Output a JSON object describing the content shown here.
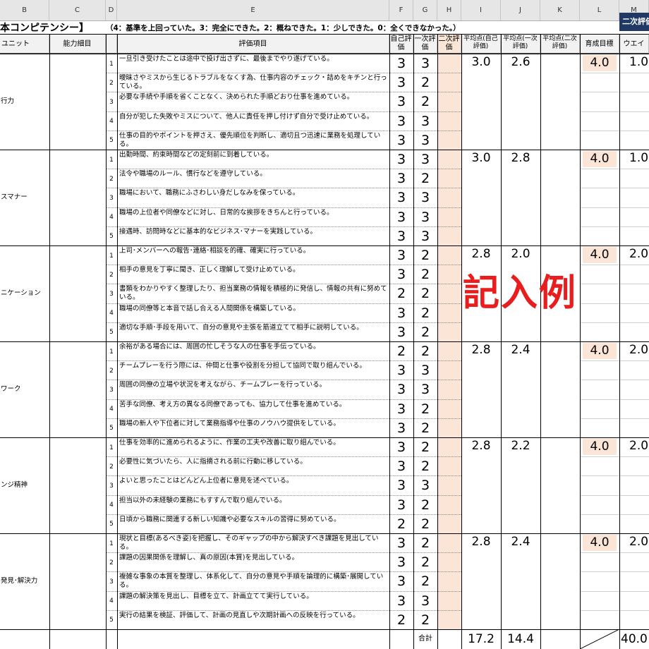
{
  "column_letters": [
    "B",
    "C",
    "D",
    "E",
    "F",
    "G",
    "H",
    "I",
    "J",
    "K",
    "L",
    "M"
  ],
  "title": "本コンピテンシー】",
  "legend": "（4：基準を上回っていた。3：完全にできた。2：概ねできた。1：少しできた。0：全くできなかった。）",
  "second_eval_tag": "二次評価",
  "headers": {
    "unit": "ユニット",
    "ability": "能力細目",
    "items": "評価項目",
    "self_eval": "自己評価",
    "first_eval": "一次評価",
    "second_eval": "二次評価",
    "avg_self": "平均点(自己評価)",
    "avg_first": "平均点(一次評価)",
    "avg_second": "平均点(二次評価)",
    "target": "育成目標",
    "weight": "ウエイ"
  },
  "watermark": "記入例",
  "groups": [
    {
      "unit": "行力",
      "avg_self": "3.0",
      "avg_first": "2.6",
      "target": "4.0",
      "weight": "1.0",
      "items": [
        {
          "no": "1",
          "text": "一旦引き受けたことは途中で投げ出さずに、最後までやり遂げている。",
          "self": "3",
          "first": "3"
        },
        {
          "no": "2",
          "text": "曖昧さやミスから生じるトラブルをなくす為、仕事内容のチェック・詰めをキチンと行っている。",
          "self": "3",
          "first": "2"
        },
        {
          "no": "3",
          "text": "必要な手続や手順を省くことなく、決められた手順どおり仕事を進めている。",
          "self": "3",
          "first": "2"
        },
        {
          "no": "4",
          "text": "自分が犯した失敗やミスについて、他人に責任を押し付けず自分で受け止めている。",
          "self": "3",
          "first": "3"
        },
        {
          "no": "5",
          "text": "仕事の目的やポイントを押さえ、優先順位を判断し、適切且つ迅速に業務を処理している。",
          "self": "3",
          "first": "3"
        }
      ]
    },
    {
      "unit": "スマナー",
      "avg_self": "3.0",
      "avg_first": "2.8",
      "target": "4.0",
      "weight": "1.0",
      "items": [
        {
          "no": "1",
          "text": "出勤時間、約束時間などの定刻前に到着している。",
          "self": "3",
          "first": "3"
        },
        {
          "no": "2",
          "text": "法令や職場のルール、慣行などを遵守している。",
          "self": "3",
          "first": "2"
        },
        {
          "no": "3",
          "text": "職場において、職務にふさわしい身だしなみを保っている。",
          "self": "3",
          "first": "3"
        },
        {
          "no": "4",
          "text": "職場の上位者や同僚などに対し、日常的な挨拶をきちんと行っている。",
          "self": "3",
          "first": "3"
        },
        {
          "no": "5",
          "text": "接遇時、訪問時などに基本的なビジネス･マナーを実践している。",
          "self": "3",
          "first": "3"
        }
      ]
    },
    {
      "unit": "ニケーション",
      "avg_self": "2.8",
      "avg_first": "2.0",
      "target": "4.0",
      "weight": "2.0",
      "items": [
        {
          "no": "1",
          "text": "上司･メンバーへの報告･連絡･相談を的確、確実に行っている。",
          "self": "3",
          "first": "2"
        },
        {
          "no": "2",
          "text": "相手の意見を丁寧に聞き、正しく理解して受け止めている。",
          "self": "3",
          "first": "2"
        },
        {
          "no": "3",
          "text": "書類をわかりやすく整理したり、担当業務の情報を積極的に発信し、情報の共有に努めている。",
          "self": "2",
          "first": "2"
        },
        {
          "no": "4",
          "text": "職場の同僚等と本音で話し合える人間関係を構築している。",
          "self": "3",
          "first": "2"
        },
        {
          "no": "5",
          "text": "適切な手順･手段を用いて、自分の意見や主張を筋道立てて相手に説明している。",
          "self": "3",
          "first": "2"
        }
      ]
    },
    {
      "unit": "ワーク",
      "avg_self": "2.8",
      "avg_first": "2.4",
      "target": "4.0",
      "weight": "2.0",
      "items": [
        {
          "no": "1",
          "text": "余裕がある場合には、周囲の忙しそうな人の仕事を手伝っている。",
          "self": "2",
          "first": "2"
        },
        {
          "no": "2",
          "text": "チームプレーを行う際には、仲間と仕事や役割を分担して協同で取り組んでいる。",
          "self": "3",
          "first": "3"
        },
        {
          "no": "3",
          "text": "周囲の同僚の立場や状況を考えながら、チームプレーを行っている。",
          "self": "3",
          "first": "3"
        },
        {
          "no": "4",
          "text": "苦手な同僚、考え方の異なる同僚であっても、協力して仕事を進めている。",
          "self": "3",
          "first": "2"
        },
        {
          "no": "5",
          "text": "職場の新人や下位者に対して業務指導や仕事のノウハウ提供をしている。",
          "self": "3",
          "first": "2"
        }
      ]
    },
    {
      "unit": "ンジ精神",
      "avg_self": "2.8",
      "avg_first": "2.2",
      "target": "4.0",
      "weight": "2.0",
      "items": [
        {
          "no": "1",
          "text": "仕事を効率的に進められるように、作業の工夫や改善に取り組んでいる。",
          "self": "3",
          "first": "2"
        },
        {
          "no": "2",
          "text": "必要性に気づいたら、人に指摘される前に行動に移している。",
          "self": "3",
          "first": "2"
        },
        {
          "no": "3",
          "text": "よいと思ったことはどんどん上位者に意見を述べている。",
          "self": "3",
          "first": "3"
        },
        {
          "no": "4",
          "text": "担当以外の未経験の業務にもすすんで取り組んでいる。",
          "self": "3",
          "first": "2"
        },
        {
          "no": "5",
          "text": "日頃から職務に関連する新しい知識や必要なスキルの習得に努めている。",
          "self": "2",
          "first": "2"
        }
      ]
    },
    {
      "unit": "発見･解決力",
      "avg_self": "2.8",
      "avg_first": "2.4",
      "target": "4.0",
      "weight": "2.0",
      "items": [
        {
          "no": "1",
          "text": "現状と目標(あるべき姿)を把握し、そのギャップの中から解決すべき課題を見出している。",
          "self": "3",
          "first": "2"
        },
        {
          "no": "2",
          "text": "課題の因果関係を理解し、真の原因(本質)を見出している。",
          "self": "3",
          "first": "2"
        },
        {
          "no": "3",
          "text": "複雑な事象の本質を整理し、体系化して、自分の意見や手順を論理的に構築･展開している。",
          "self": "3",
          "first": "2"
        },
        {
          "no": "4",
          "text": "課題の解決策を見出し、目標を立て、計画立てて実行している。",
          "self": "3",
          "first": "3"
        },
        {
          "no": "5",
          "text": "実行の結果を検証、評価して、計画の見直しや次期計画への反映を行っている。",
          "self": "2",
          "first": "2"
        }
      ]
    }
  ],
  "totals": {
    "label": "合計",
    "avg_self": "17.2",
    "avg_first": "14.4",
    "weight": "40.0"
  }
}
